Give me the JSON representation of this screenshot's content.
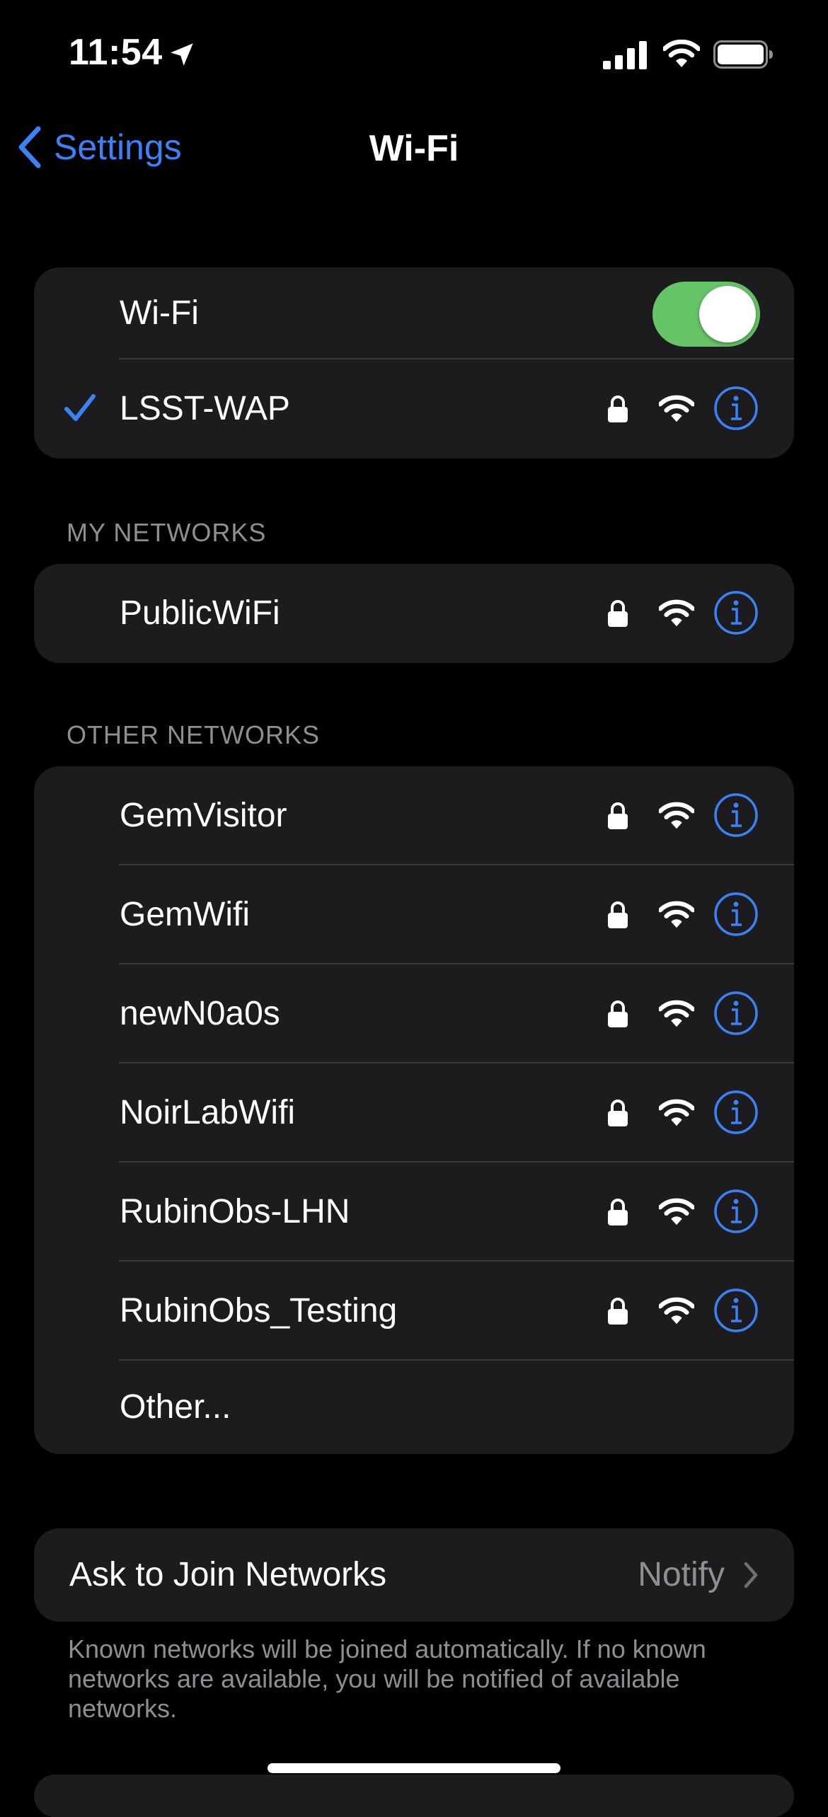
{
  "status_bar": {
    "time": "11:54",
    "icons": [
      "location-arrow-icon",
      "cellular-signal-icon",
      "wifi-icon",
      "battery-icon"
    ]
  },
  "nav": {
    "back_label": "Settings",
    "title": "Wi-Fi"
  },
  "wifi_group": {
    "toggle_label": "Wi-Fi",
    "toggle_on": true,
    "connected_network": "LSST-WAP"
  },
  "my_networks": {
    "header": "MY NETWORKS",
    "items": [
      {
        "name": "PublicWiFi",
        "secured": true
      }
    ]
  },
  "other_networks": {
    "header": "OTHER NETWORKS",
    "items": [
      {
        "name": "GemVisitor",
        "secured": true
      },
      {
        "name": "GemWifi",
        "secured": true
      },
      {
        "name": "newN0a0s",
        "secured": true
      },
      {
        "name": "NoirLabWifi",
        "secured": true
      },
      {
        "name": "RubinObs-LHN",
        "secured": true
      },
      {
        "name": "RubinObs_Testing",
        "secured": true
      }
    ],
    "other_label": "Other..."
  },
  "ask_to_join": {
    "label": "Ask to Join Networks",
    "value": "Notify",
    "footnote": "Known networks will be joined automatically. If no known networks are available, you will be notified of available networks."
  },
  "colors": {
    "accent": "#3b82f6",
    "toggle_on": "#65c466",
    "group_bg": "#1c1c1e",
    "secondary_text": "#8e8e93"
  }
}
